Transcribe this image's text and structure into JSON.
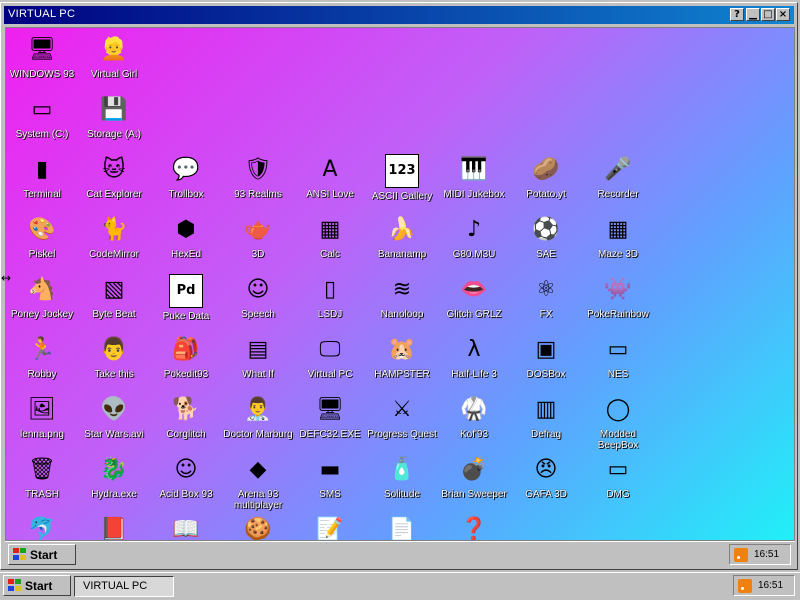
{
  "window": {
    "title": "VIRTUAL PC",
    "help": "?",
    "minimize": "▁",
    "maximize": "□",
    "close": "×"
  },
  "desktop_icons": [
    {
      "label": "WINDOWS 93",
      "icon": "computer-icon",
      "glyph": "🖥"
    },
    {
      "label": "Virtual Girl",
      "icon": "girl-photo-icon",
      "glyph": "👱"
    },
    {
      "label": "System (C:)",
      "icon": "hard-drive-icon",
      "glyph": "▭"
    },
    {
      "label": "Storage (A:)",
      "icon": "floppy-drive-icon",
      "glyph": "💾"
    },
    {
      "label": "Terminal",
      "icon": "terminal-icon",
      "glyph": "▮"
    },
    {
      "label": "Cat Explorer",
      "icon": "cat-globe-icon",
      "glyph": "🐱"
    },
    {
      "label": "Trollbox",
      "icon": "chat-bubbles-icon",
      "glyph": "💬"
    },
    {
      "label": "93 Realms",
      "icon": "knight-icon",
      "glyph": "🛡"
    },
    {
      "label": "ANSI Love",
      "icon": "ansi-letter-icon",
      "glyph": "A"
    },
    {
      "label": "ASCII Gallery",
      "icon": "ascii-numbers-icon",
      "glyph": "123"
    },
    {
      "label": "MIDI Jukebox",
      "icon": "piano-keys-icon",
      "glyph": "🎹"
    },
    {
      "label": "Potato.yt",
      "icon": "potato-icon",
      "glyph": "🥔"
    },
    {
      "label": "Recorder",
      "icon": "microphone-icon",
      "glyph": "🎤"
    },
    {
      "label": "Piskel",
      "icon": "palette-icon",
      "glyph": "🎨"
    },
    {
      "label": "CodeMirror",
      "icon": "codemirror-icon",
      "glyph": "🐈"
    },
    {
      "label": "HexEd",
      "icon": "hex-cube-icon",
      "glyph": "⬢"
    },
    {
      "label": "3D",
      "icon": "teapot-icon",
      "glyph": "🫖"
    },
    {
      "label": "Calc",
      "icon": "calculator-icon",
      "glyph": "▦"
    },
    {
      "label": "Bananamp",
      "icon": "banana-icon",
      "glyph": "🍌"
    },
    {
      "label": "G80.M3U",
      "icon": "music-file-icon",
      "glyph": "♪"
    },
    {
      "label": "SAE",
      "icon": "amiga-ball-icon",
      "glyph": "⚽"
    },
    {
      "label": "Maze 3D",
      "icon": "maze-icon",
      "glyph": "▦"
    },
    {
      "label": "Poney Jockey",
      "icon": "pony-icon",
      "glyph": "🐴"
    },
    {
      "label": "Byte Beat",
      "icon": "bytebeat-icon",
      "glyph": "▧"
    },
    {
      "label": "Puke Data",
      "icon": "pd-icon",
      "glyph": "Pd"
    },
    {
      "label": "Speech",
      "icon": "face-icon",
      "glyph": "☺"
    },
    {
      "label": "LSDJ",
      "icon": "gameboy-icon",
      "glyph": "▯"
    },
    {
      "label": "Nanoloop",
      "icon": "waves-icon",
      "glyph": "≋"
    },
    {
      "label": "Glitch GRLZ",
      "icon": "lips-icon",
      "glyph": "👄"
    },
    {
      "label": "FX",
      "icon": "atom-icon",
      "glyph": "⚛"
    },
    {
      "label": "PokeRainbow",
      "icon": "pokemon-trainers-icon",
      "glyph": "👾"
    },
    {
      "label": "Robby",
      "icon": "stick-figure-icon",
      "glyph": "🏃"
    },
    {
      "label": "Take this",
      "icon": "pixel-man-icon",
      "glyph": "👨"
    },
    {
      "label": "Pokedit93",
      "icon": "pokeball-bag-icon",
      "glyph": "🎒"
    },
    {
      "label": "What If",
      "icon": "what-if-icon",
      "glyph": "▤"
    },
    {
      "label": "Virtual PC",
      "icon": "virtual-pc-icon",
      "glyph": "🖵"
    },
    {
      "label": "HAMPSTER",
      "icon": "hamster-icon",
      "glyph": "🐹"
    },
    {
      "label": "Half-Life 3",
      "icon": "lambda-icon",
      "glyph": "λ"
    },
    {
      "label": "DOSBox",
      "icon": "dosbox-icon",
      "glyph": "▣"
    },
    {
      "label": "NES",
      "icon": "nes-console-icon",
      "glyph": "▭"
    },
    {
      "label": "lenna.png",
      "icon": "image-file-icon",
      "glyph": "🖼"
    },
    {
      "label": "Star Wars.avi",
      "icon": "yoda-icon",
      "glyph": "👽"
    },
    {
      "label": "Corglitch",
      "icon": "corgi-icon",
      "glyph": "🐕"
    },
    {
      "label": "Doctor Marburg",
      "icon": "doctor-icon",
      "glyph": "👨‍⚕"
    },
    {
      "label": "DEFC32.EXE",
      "icon": "monitor-face-icon",
      "glyph": "🖥"
    },
    {
      "label": "Progress Quest",
      "icon": "crossed-swords-icon",
      "glyph": "⚔"
    },
    {
      "label": "Kof'93",
      "icon": "fighter-icon",
      "glyph": "🥋"
    },
    {
      "label": "Defrag",
      "icon": "defrag-icon",
      "glyph": "▥"
    },
    {
      "label": "Modded BeepBox",
      "icon": "beepbox-ring-icon",
      "glyph": "◯"
    },
    {
      "label": "TRASH",
      "icon": "trash-icon",
      "glyph": "🗑"
    },
    {
      "label": "Hydra.exe",
      "icon": "hydra-icon",
      "glyph": "🐉"
    },
    {
      "label": "Acid Box 93",
      "icon": "smiley-icon",
      "glyph": "☺"
    },
    {
      "label": "Arena 93 multiplayer",
      "icon": "cube-icon",
      "glyph": "◆"
    },
    {
      "label": "SMS",
      "icon": "sms-console-icon",
      "glyph": "▬"
    },
    {
      "label": "Solitude",
      "icon": "bottle-icon",
      "glyph": "🧴"
    },
    {
      "label": "Brian Sweeper",
      "icon": "mine-icon",
      "glyph": "💣"
    },
    {
      "label": "GAFA 3D",
      "icon": "doom-face-icon",
      "glyph": "😠"
    },
    {
      "label": "DMG",
      "icon": "dmg-icon",
      "glyph": "▭"
    },
    {
      "label": "",
      "icon": "dolphin-icon",
      "glyph": "🐬"
    },
    {
      "label": "",
      "icon": "document-red-icon",
      "glyph": "📕"
    },
    {
      "label": "",
      "icon": "book-icon",
      "glyph": "📖"
    },
    {
      "label": "",
      "icon": "cookie-icon",
      "glyph": "🍪"
    },
    {
      "label": "",
      "icon": "notepad-icon",
      "glyph": "📝"
    },
    {
      "label": "",
      "icon": "text-file-icon",
      "glyph": "📄"
    },
    {
      "label": "",
      "icon": "help-question-icon",
      "glyph": "❓"
    }
  ],
  "inner_taskbar": {
    "start_label": "Start",
    "clock": "16:51"
  },
  "outer_taskbar": {
    "start_label": "Start",
    "task_label": "VIRTUAL PC",
    "clock": "16:51"
  }
}
